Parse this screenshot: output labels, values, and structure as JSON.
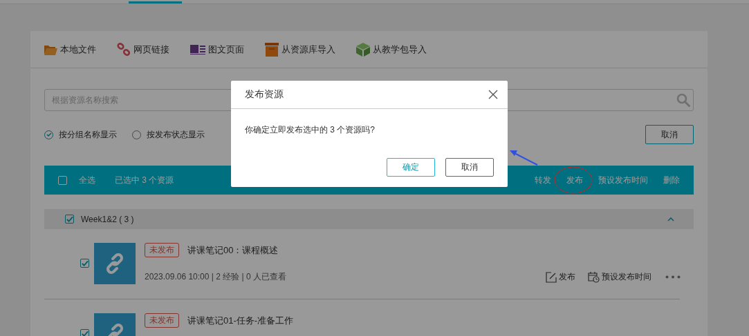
{
  "toolbar": [
    {
      "label": "本地文件",
      "kind": "folder"
    },
    {
      "label": "网页链接",
      "kind": "link"
    },
    {
      "label": "图文页面",
      "kind": "page"
    },
    {
      "label": "从资源库导入",
      "kind": "library"
    },
    {
      "label": "从教学包导入",
      "kind": "package"
    }
  ],
  "search": {
    "placeholder": "根据资源名称搜索"
  },
  "view_options": [
    {
      "label": "按分组名称显示",
      "selected": true
    },
    {
      "label": "按发布状态显示",
      "selected": false
    }
  ],
  "cancel_button": "取消",
  "bulk_bar": {
    "select_all": {
      "label": "全选",
      "checked": false
    },
    "selection_count": "已选中 3 个资源",
    "actions": [
      "转发",
      "发布",
      "预设发布时间",
      "删除"
    ]
  },
  "group": {
    "name": "Week1&2 ( 3 )",
    "checked": true,
    "expanded": true
  },
  "resources": [
    {
      "status": "未发布",
      "title": "讲课笔记00：课程概述",
      "checked": true,
      "meta": "2023.09.06 10:00 | 2 经验 | 0 人已查看",
      "actions": [
        {
          "label": "发布",
          "kind": "publish"
        },
        {
          "label": "预设发布时间",
          "kind": "schedule"
        }
      ]
    },
    {
      "status": "未发布",
      "title": "讲课笔记01-任务-准备工作",
      "checked": true
    }
  ],
  "dialog": {
    "title": "发布资源",
    "message": "你确定立即发布选中的 3 个资源吗?",
    "buttons": [
      {
        "label": "确定",
        "kind": "primary"
      },
      {
        "label": "取消",
        "kind": "secondary"
      }
    ]
  }
}
